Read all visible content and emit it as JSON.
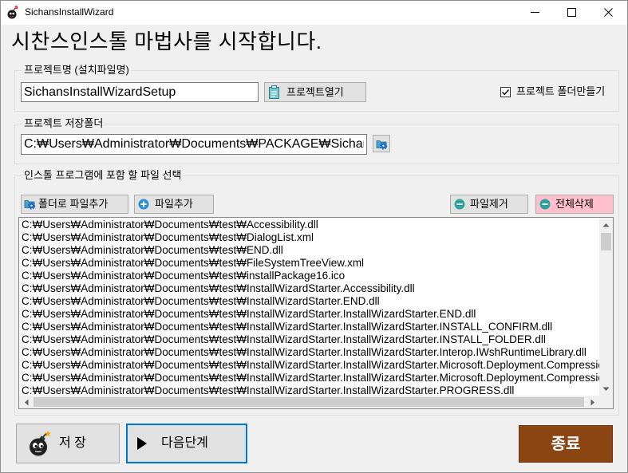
{
  "window": {
    "title": "SichansInstallWizard",
    "app_icon": "bomb-icon",
    "controls": [
      "minimize-icon",
      "maximize-icon",
      "close-icon"
    ]
  },
  "heading": "시찬스인스톨 마법사를 시작합니다.",
  "project_name": {
    "group_label": "프로젝트명 (설치파일명)",
    "value": "SichansInstallWizardSetup",
    "open_button": {
      "label": "프로젝트열기",
      "icon": "clipboard-icon"
    },
    "make_folder": {
      "label": "프로젝트 폴더만들기",
      "checked": true
    }
  },
  "save_folder": {
    "group_label": "프로젝트 저장폴더",
    "value": "C:₩Users₩Administrator₩Documents₩PACKAGE₩Sichan",
    "browse_button": {
      "icon": "folder-gear-icon"
    }
  },
  "files": {
    "group_label": "인스톨 프로그램에 포함 할 파일 선택",
    "add_folder_button": {
      "label": "폴더로 파일추가",
      "icon": "folder-gear-icon"
    },
    "add_file_button": {
      "label": "파일추가",
      "icon": "plus-circle-icon"
    },
    "remove_file_button": {
      "label": "파일제거",
      "icon": "minus-circle-icon"
    },
    "remove_all_button": {
      "label": "전체삭제",
      "icon": "minus-circle-icon"
    },
    "items": [
      "C:₩Users₩Administrator₩Documents₩test₩Accessibility.dll",
      "C:₩Users₩Administrator₩Documents₩test₩DialogList.xml",
      "C:₩Users₩Administrator₩Documents₩test₩END.dll",
      "C:₩Users₩Administrator₩Documents₩test₩FileSystemTreeView.xml",
      "C:₩Users₩Administrator₩Documents₩test₩installPackage16.ico",
      "C:₩Users₩Administrator₩Documents₩test₩InstallWizardStarter.Accessibility.dll",
      "C:₩Users₩Administrator₩Documents₩test₩InstallWizardStarter.END.dll",
      "C:₩Users₩Administrator₩Documents₩test₩InstallWizardStarter.InstallWizardStarter.END.dll",
      "C:₩Users₩Administrator₩Documents₩test₩InstallWizardStarter.InstallWizardStarter.INSTALL_CONFIRM.dll",
      "C:₩Users₩Administrator₩Documents₩test₩InstallWizardStarter.InstallWizardStarter.INSTALL_FOLDER.dll",
      "C:₩Users₩Administrator₩Documents₩test₩InstallWizardStarter.InstallWizardStarter.Interop.IWshRuntimeLibrary.dll",
      "C:₩Users₩Administrator₩Documents₩test₩InstallWizardStarter.InstallWizardStarter.Microsoft.Deployment.Compressio",
      "C:₩Users₩Administrator₩Documents₩test₩InstallWizardStarter.InstallWizardStarter.Microsoft.Deployment.Compressio",
      "C:₩Users₩Administrator₩Documents₩test₩InstallWizardStarter.InstallWizardStarter.PROGRESS.dll"
    ]
  },
  "footer": {
    "save_button": {
      "label": "저 장",
      "icon": "bomb-face-icon"
    },
    "next_button": {
      "label": "다음단계",
      "icon": "play-icon"
    },
    "exit_button": {
      "label": "종료"
    }
  },
  "colors": {
    "window_background": "#f0f0f0",
    "remove_all_background": "#ffc0cb",
    "exit_background": "#8b4513",
    "exit_text": "#ffffff",
    "focus_border": "#0078d7"
  }
}
